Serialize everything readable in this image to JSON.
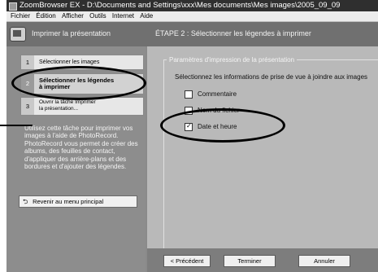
{
  "window": {
    "title": "ZoomBrowser EX  -  D:\\Documents and Settings\\xxx\\Mes documents\\Mes images\\2005_09_09"
  },
  "menu": [
    "Fichier",
    "Édition",
    "Afficher",
    "Outils",
    "Internet",
    "Aide"
  ],
  "header": {
    "section": "Imprimer la présentation",
    "step_title": "ÉTAPE 2 : Sélectionner les légendes à imprimer"
  },
  "steps": [
    {
      "num": "1",
      "label": "Sélectionner les images"
    },
    {
      "num": "2",
      "label_line1": "Sélectionner les légendes",
      "label_line2": "à imprimer"
    },
    {
      "num": "3",
      "label_line1": "Ouvrir la tâche Imprimer",
      "label_line2": "la présentation..."
    }
  ],
  "description": "Utilisez cette tâche pour imprimer vos images à l'aide de PhotoRecord. PhotoRecord vous permet de créer des albums, des feuilles de contact, d'appliquer des arrière-plans et des bordures et d'ajouter des légendes.",
  "back_button": "Revenir au menu principal",
  "group": {
    "title": "Paramètres d'impression de la présentation",
    "instruction": "Sélectionnez les informations de prise de vue à joindre aux images",
    "options": [
      {
        "label": "Commentaire",
        "checked": false
      },
      {
        "label": "Nom du fichier",
        "checked": false
      },
      {
        "label": "Date et heure",
        "checked": true
      }
    ]
  },
  "footer": {
    "prev": "< Précédent",
    "finish": "Terminer",
    "cancel": "Annuler"
  }
}
